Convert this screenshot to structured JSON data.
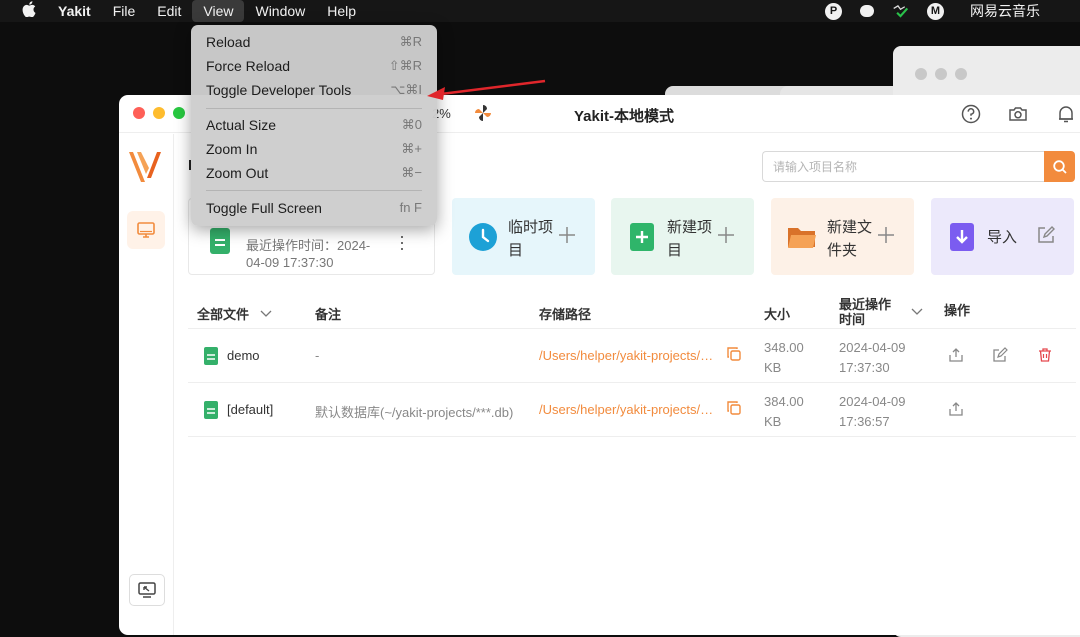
{
  "menubar": {
    "apple": "",
    "app_name": "Yakit",
    "items": [
      "File",
      "Edit",
      "View",
      "Window",
      "Help"
    ],
    "active_item": "View",
    "tray": [
      "P",
      "",
      "",
      "M"
    ],
    "tray_label": "网易云音乐"
  },
  "view_menu": {
    "items": [
      {
        "label": "Reload",
        "shortcut": "⌘R"
      },
      {
        "label": "Force Reload",
        "shortcut": "⇧⌘R"
      },
      {
        "label": "Toggle Developer Tools",
        "shortcut": "⌥⌘I"
      },
      {
        "label": "Actual Size",
        "shortcut": "⌘0"
      },
      {
        "label": "Zoom In",
        "shortcut": "⌘+"
      },
      {
        "label": "Zoom Out",
        "shortcut": "⌘−"
      },
      {
        "label": "Toggle Full Screen",
        "shortcut": "fn F"
      }
    ]
  },
  "window": {
    "title": "Yakit-本地模式",
    "zoom_fragment": "2%",
    "page_title_fragment": "I"
  },
  "search": {
    "placeholder": "请输入项目名称"
  },
  "recent": {
    "label": "最近操作时间：2024-",
    "time": "04-09 17:37:30"
  },
  "quick_actions": [
    {
      "label_line1": "临时项",
      "label_line2": "目",
      "color": "#1da1d6"
    },
    {
      "label_line1": "新建项",
      "label_line2": "目",
      "color": "#2fb56a"
    },
    {
      "label_line1": "新建文",
      "label_line2": "件夹",
      "color": "#f28b3d"
    },
    {
      "label": "导入",
      "color": "#7b5cf0"
    }
  ],
  "table": {
    "headers": {
      "files": "全部文件",
      "note": "备注",
      "path": "存储路径",
      "size": "大小",
      "time_line1": "最近操作",
      "time_line2": "时间",
      "actions": "操作"
    },
    "rows": [
      {
        "name": "demo",
        "note": "-",
        "path": "/Users/helper/yakit-projects/projects/demo.db",
        "size_value": "348.00",
        "size_unit": "KB",
        "date": "2024-04-09",
        "time": "17:37:30"
      },
      {
        "name": "[default]",
        "note": "默认数据库(~/yakit-projects/***.db)",
        "path": "/Users/helper/yakit-projects/default-yakit.db",
        "size_value": "384.00",
        "size_unit": "KB",
        "date": "2024-04-09",
        "time": "17:36:57"
      }
    ]
  },
  "colors": {
    "accent": "#f28b3d",
    "delete": "#e5484d",
    "arrow": "#e0262b"
  }
}
